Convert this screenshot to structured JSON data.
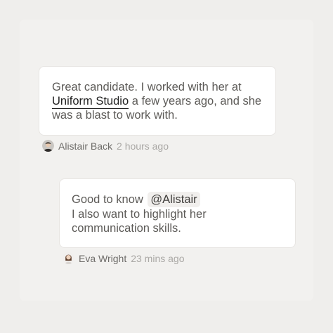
{
  "comments": [
    {
      "text_before_link": "Great candidate. I worked with her at ",
      "link_text": "Uniform Studio",
      "text_after_link": " a few years ago, and she was a blast to work with.",
      "author": "Alistair Back",
      "time": "2 hours ago",
      "avatar_icon": "person-avatar-dark-hair"
    },
    {
      "line1_prefix": "Good to know ",
      "mention": "@Alistair",
      "line2": "I also want to highlight her",
      "line3": "communication skills.",
      "author": "Eva Wright",
      "time": "23 mins ago",
      "avatar_icon": "person-avatar-brown-hair"
    }
  ],
  "colors": {
    "background": "#efeeec",
    "bubble": "#ffffff",
    "text": "#5c5a57",
    "link": "#222222",
    "mention_bg": "#f1efed",
    "timestamp": "#aaa8a5"
  }
}
